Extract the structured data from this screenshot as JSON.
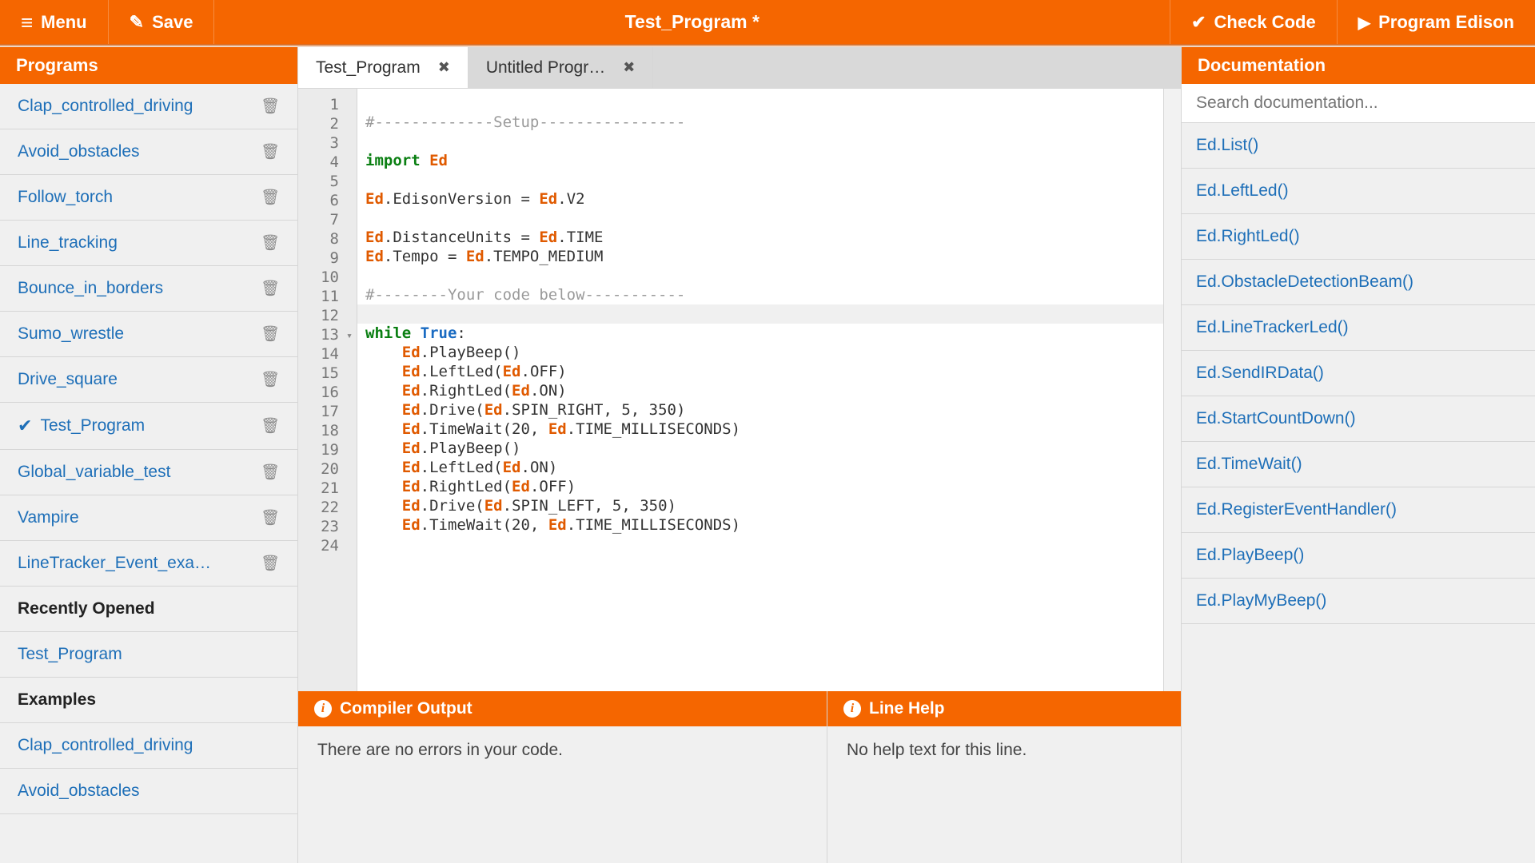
{
  "colors": {
    "accent": "#f56600",
    "link": "#1e6fb8"
  },
  "header": {
    "menu_label": "Menu",
    "save_label": "Save",
    "title": "Test_Program *",
    "check_label": "Check Code",
    "program_label": "Program Edison"
  },
  "sidebar": {
    "title": "Programs",
    "programs": [
      {
        "name": "Clap_controlled_driving",
        "active": false
      },
      {
        "name": "Avoid_obstacles",
        "active": false
      },
      {
        "name": "Follow_torch",
        "active": false
      },
      {
        "name": "Line_tracking",
        "active": false
      },
      {
        "name": "Bounce_in_borders",
        "active": false
      },
      {
        "name": "Sumo_wrestle",
        "active": false
      },
      {
        "name": "Drive_square",
        "active": false
      },
      {
        "name": "Test_Program",
        "active": true
      },
      {
        "name": "Global_variable_test",
        "active": false
      },
      {
        "name": "Vampire",
        "active": false
      },
      {
        "name": "LineTracker_Event_exa…",
        "active": false
      }
    ],
    "recent_title": "Recently Opened",
    "recent": [
      {
        "name": "Test_Program"
      }
    ],
    "examples_title": "Examples",
    "examples": [
      {
        "name": "Clap_controlled_driving"
      },
      {
        "name": "Avoid_obstacles"
      }
    ]
  },
  "tabs": [
    {
      "label": "Test_Program",
      "active": true
    },
    {
      "label": "Untitled Progr…",
      "active": false
    }
  ],
  "editor": {
    "highlighted_line": 12,
    "fold_line": 13,
    "lines": [
      {
        "n": 1,
        "tokens": []
      },
      {
        "n": 2,
        "tokens": [
          {
            "t": "#-------------Setup----------------",
            "c": "c-grey"
          }
        ]
      },
      {
        "n": 3,
        "tokens": []
      },
      {
        "n": 4,
        "tokens": [
          {
            "t": "import ",
            "c": "c-kw"
          },
          {
            "t": "Ed",
            "c": "c-obj"
          }
        ]
      },
      {
        "n": 5,
        "tokens": []
      },
      {
        "n": 6,
        "tokens": [
          {
            "t": "Ed",
            "c": "c-obj"
          },
          {
            "t": ".EdisonVersion = "
          },
          {
            "t": "Ed",
            "c": "c-obj"
          },
          {
            "t": ".V2"
          }
        ]
      },
      {
        "n": 7,
        "tokens": []
      },
      {
        "n": 8,
        "tokens": [
          {
            "t": "Ed",
            "c": "c-obj"
          },
          {
            "t": ".DistanceUnits = "
          },
          {
            "t": "Ed",
            "c": "c-obj"
          },
          {
            "t": ".TIME"
          }
        ]
      },
      {
        "n": 9,
        "tokens": [
          {
            "t": "Ed",
            "c": "c-obj"
          },
          {
            "t": ".Tempo = "
          },
          {
            "t": "Ed",
            "c": "c-obj"
          },
          {
            "t": ".TEMPO_MEDIUM"
          }
        ]
      },
      {
        "n": 10,
        "tokens": []
      },
      {
        "n": 11,
        "tokens": [
          {
            "t": "#--------Your code below-----------",
            "c": "c-grey"
          }
        ]
      },
      {
        "n": 12,
        "tokens": []
      },
      {
        "n": 13,
        "tokens": [
          {
            "t": "while ",
            "c": "c-kw"
          },
          {
            "t": "True",
            "c": "c-attr"
          },
          {
            "t": ":"
          }
        ]
      },
      {
        "n": 14,
        "tokens": [
          {
            "t": "    "
          },
          {
            "t": "Ed",
            "c": "c-obj"
          },
          {
            "t": ".PlayBeep()"
          }
        ]
      },
      {
        "n": 15,
        "tokens": [
          {
            "t": "    "
          },
          {
            "t": "Ed",
            "c": "c-obj"
          },
          {
            "t": ".LeftLed("
          },
          {
            "t": "Ed",
            "c": "c-obj"
          },
          {
            "t": ".OFF)"
          }
        ]
      },
      {
        "n": 16,
        "tokens": [
          {
            "t": "    "
          },
          {
            "t": "Ed",
            "c": "c-obj"
          },
          {
            "t": ".RightLed("
          },
          {
            "t": "Ed",
            "c": "c-obj"
          },
          {
            "t": ".ON)"
          }
        ]
      },
      {
        "n": 17,
        "tokens": [
          {
            "t": "    "
          },
          {
            "t": "Ed",
            "c": "c-obj"
          },
          {
            "t": ".Drive("
          },
          {
            "t": "Ed",
            "c": "c-obj"
          },
          {
            "t": ".SPIN_RIGHT, 5, 350)"
          }
        ]
      },
      {
        "n": 18,
        "tokens": [
          {
            "t": "    "
          },
          {
            "t": "Ed",
            "c": "c-obj"
          },
          {
            "t": ".TimeWait(20, "
          },
          {
            "t": "Ed",
            "c": "c-obj"
          },
          {
            "t": ".TIME_MILLISECONDS)"
          }
        ]
      },
      {
        "n": 19,
        "tokens": [
          {
            "t": "    "
          },
          {
            "t": "Ed",
            "c": "c-obj"
          },
          {
            "t": ".PlayBeep()"
          }
        ]
      },
      {
        "n": 20,
        "tokens": [
          {
            "t": "    "
          },
          {
            "t": "Ed",
            "c": "c-obj"
          },
          {
            "t": ".LeftLed("
          },
          {
            "t": "Ed",
            "c": "c-obj"
          },
          {
            "t": ".ON)"
          }
        ]
      },
      {
        "n": 21,
        "tokens": [
          {
            "t": "    "
          },
          {
            "t": "Ed",
            "c": "c-obj"
          },
          {
            "t": ".RightLed("
          },
          {
            "t": "Ed",
            "c": "c-obj"
          },
          {
            "t": ".OFF)"
          }
        ]
      },
      {
        "n": 22,
        "tokens": [
          {
            "t": "    "
          },
          {
            "t": "Ed",
            "c": "c-obj"
          },
          {
            "t": ".Drive("
          },
          {
            "t": "Ed",
            "c": "c-obj"
          },
          {
            "t": ".SPIN_LEFT, 5, 350)"
          }
        ]
      },
      {
        "n": 23,
        "tokens": [
          {
            "t": "    "
          },
          {
            "t": "Ed",
            "c": "c-obj"
          },
          {
            "t": ".TimeWait(20, "
          },
          {
            "t": "Ed",
            "c": "c-obj"
          },
          {
            "t": ".TIME_MILLISECONDS)"
          }
        ]
      },
      {
        "n": 24,
        "tokens": []
      }
    ]
  },
  "docs": {
    "title": "Documentation",
    "search_placeholder": "Search documentation...",
    "items": [
      "Ed.List()",
      "Ed.LeftLed()",
      "Ed.RightLed()",
      "Ed.ObstacleDetectionBeam()",
      "Ed.LineTrackerLed()",
      "Ed.SendIRData()",
      "Ed.StartCountDown()",
      "Ed.TimeWait()",
      "Ed.RegisterEventHandler()",
      "Ed.PlayBeep()",
      "Ed.PlayMyBeep()"
    ]
  },
  "compiler": {
    "title": "Compiler Output",
    "body": "There are no errors in your code."
  },
  "linehelp": {
    "title": "Line Help",
    "body": "No help text for this line."
  }
}
